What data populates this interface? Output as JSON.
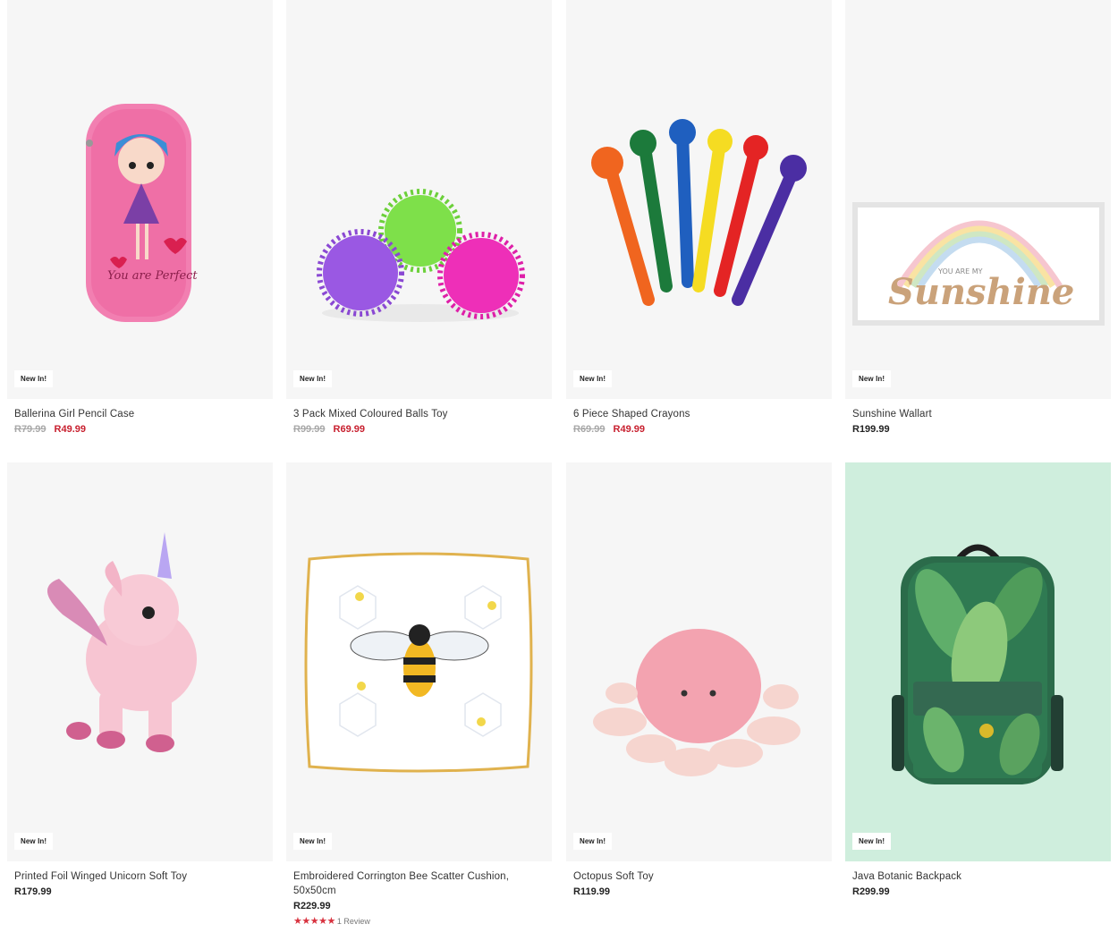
{
  "badge_label": "New In!",
  "products": [
    {
      "title": "Ballerina Girl Pencil Case",
      "was": "R79.99",
      "now": "R49.99"
    },
    {
      "title": "3 Pack Mixed Coloured Balls Toy",
      "was": "R99.99",
      "now": "R69.99"
    },
    {
      "title": "6 Piece Shaped Crayons",
      "was": "R69.99",
      "now": "R49.99"
    },
    {
      "title": "Sunshine Wallart",
      "now": "R199.99"
    },
    {
      "title": "Printed Foil Winged Unicorn Soft Toy",
      "now": "R179.99"
    },
    {
      "title": "Embroidered Corrington Bee Scatter Cushion, 50x50cm",
      "now": "R229.99",
      "stars": "★★★★★",
      "review_count": "1 Review"
    },
    {
      "title": "Octopus Soft Toy",
      "now": "R119.99"
    },
    {
      "title": "Java Botanic Backpack",
      "now": "R299.99"
    }
  ],
  "colors": {
    "sale": "#c8202f",
    "strike": "#a8a8a8",
    "star": "#d8323f",
    "image_bg": "#f6f6f6"
  },
  "artwork": {
    "pencil_case_text": "You are Perfect",
    "wallart_small": "YOU ARE MY",
    "wallart_big": "Sunshine"
  }
}
